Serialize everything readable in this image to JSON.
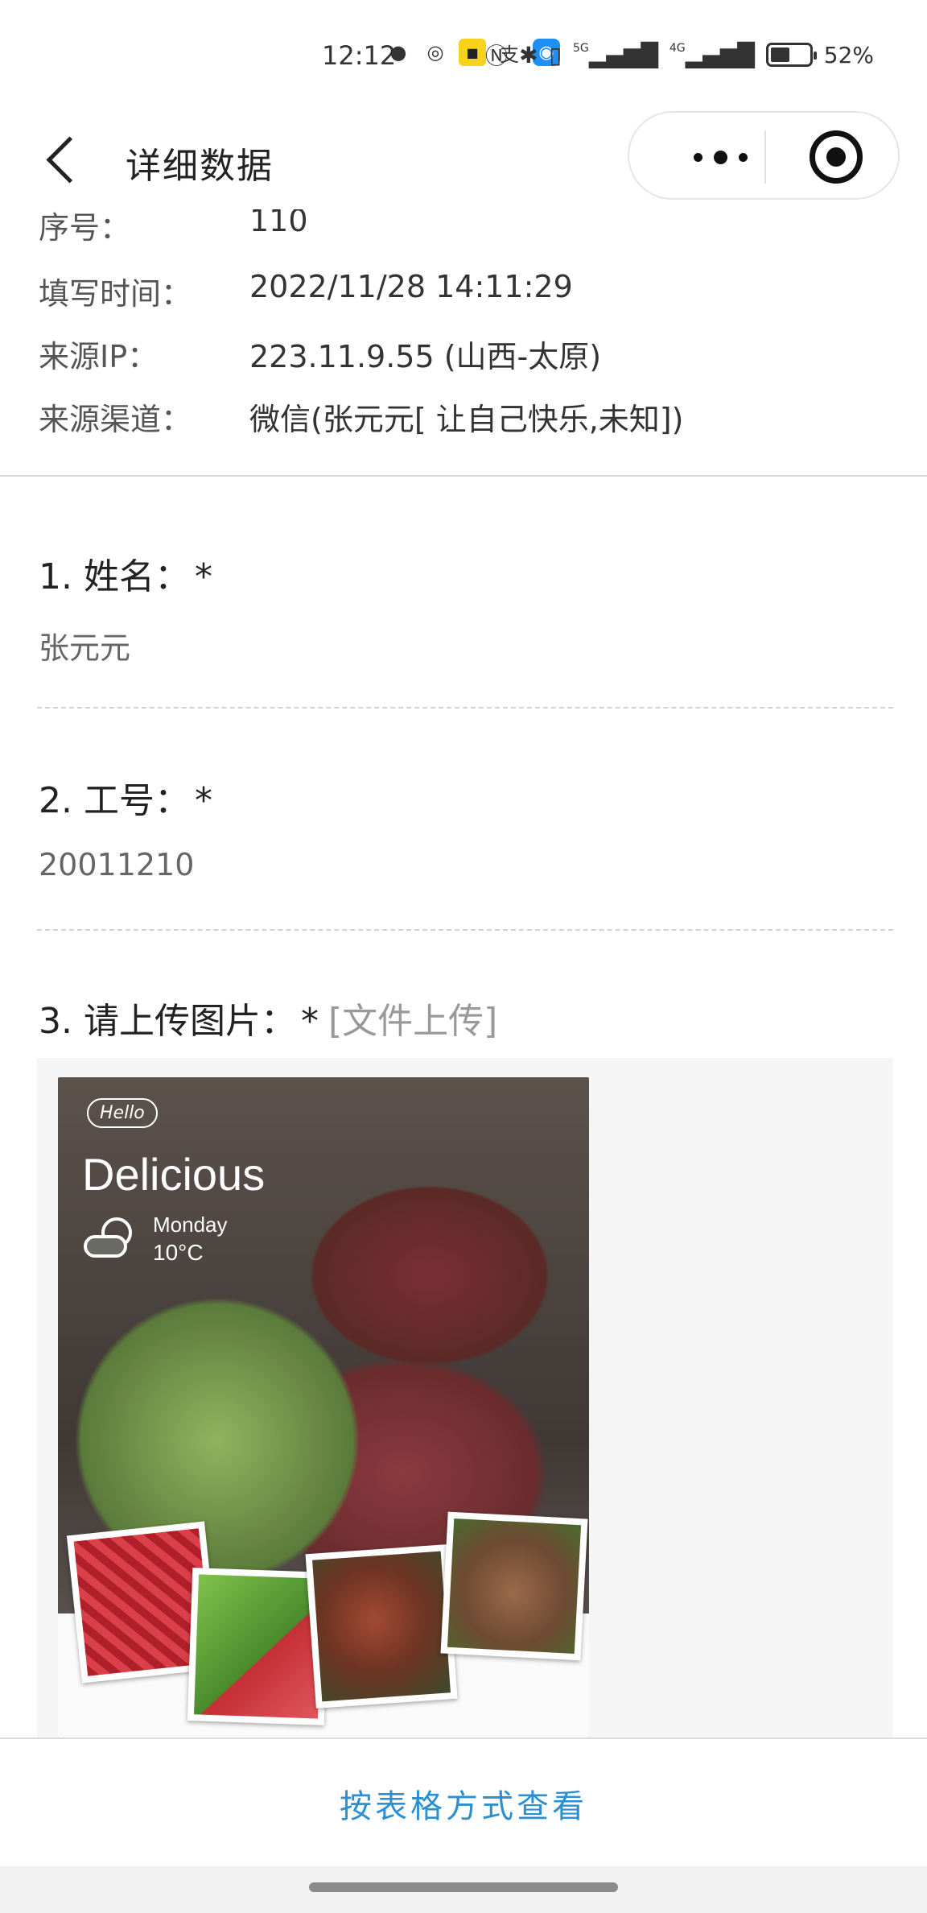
{
  "status_bar": {
    "time": "12:12",
    "network_5g": "5G",
    "network_4g": "4G",
    "battery_percent": "52%",
    "battery_level": 0.52,
    "icons": [
      "message-icon",
      "weather-icon",
      "taobao-icon",
      "alipay-icon",
      "app-icon",
      "nfc-icon",
      "bluetooth-icon",
      "vibrate-icon",
      "signal-5g-icon",
      "signal-4g-icon",
      "battery-icon"
    ]
  },
  "nav": {
    "title": "详细数据"
  },
  "meta": {
    "rows": [
      {
        "label": "序号：",
        "value": "110"
      },
      {
        "label": "填写时间：",
        "value": "2022/11/28 14:11:29"
      },
      {
        "label": "来源IP：",
        "value": "223.11.9.55 (山西-太原)"
      },
      {
        "label": "来源渠道：",
        "value": "微信(张元元[ 让自己快乐,未知])"
      }
    ]
  },
  "questions": [
    {
      "label": "1. 姓名：",
      "required": "*",
      "answer": "张元元"
    },
    {
      "label": "2. 工号：",
      "required": "*",
      "answer": "20011210"
    },
    {
      "label": "3. 请上传图片：",
      "required": "*",
      "tag": "[文件上传]"
    }
  ],
  "photo": {
    "hello": "Hello",
    "title": "Delicious",
    "day": "Monday",
    "temperature": "10°C"
  },
  "footer": {
    "table_view_label": "按表格方式查看"
  }
}
